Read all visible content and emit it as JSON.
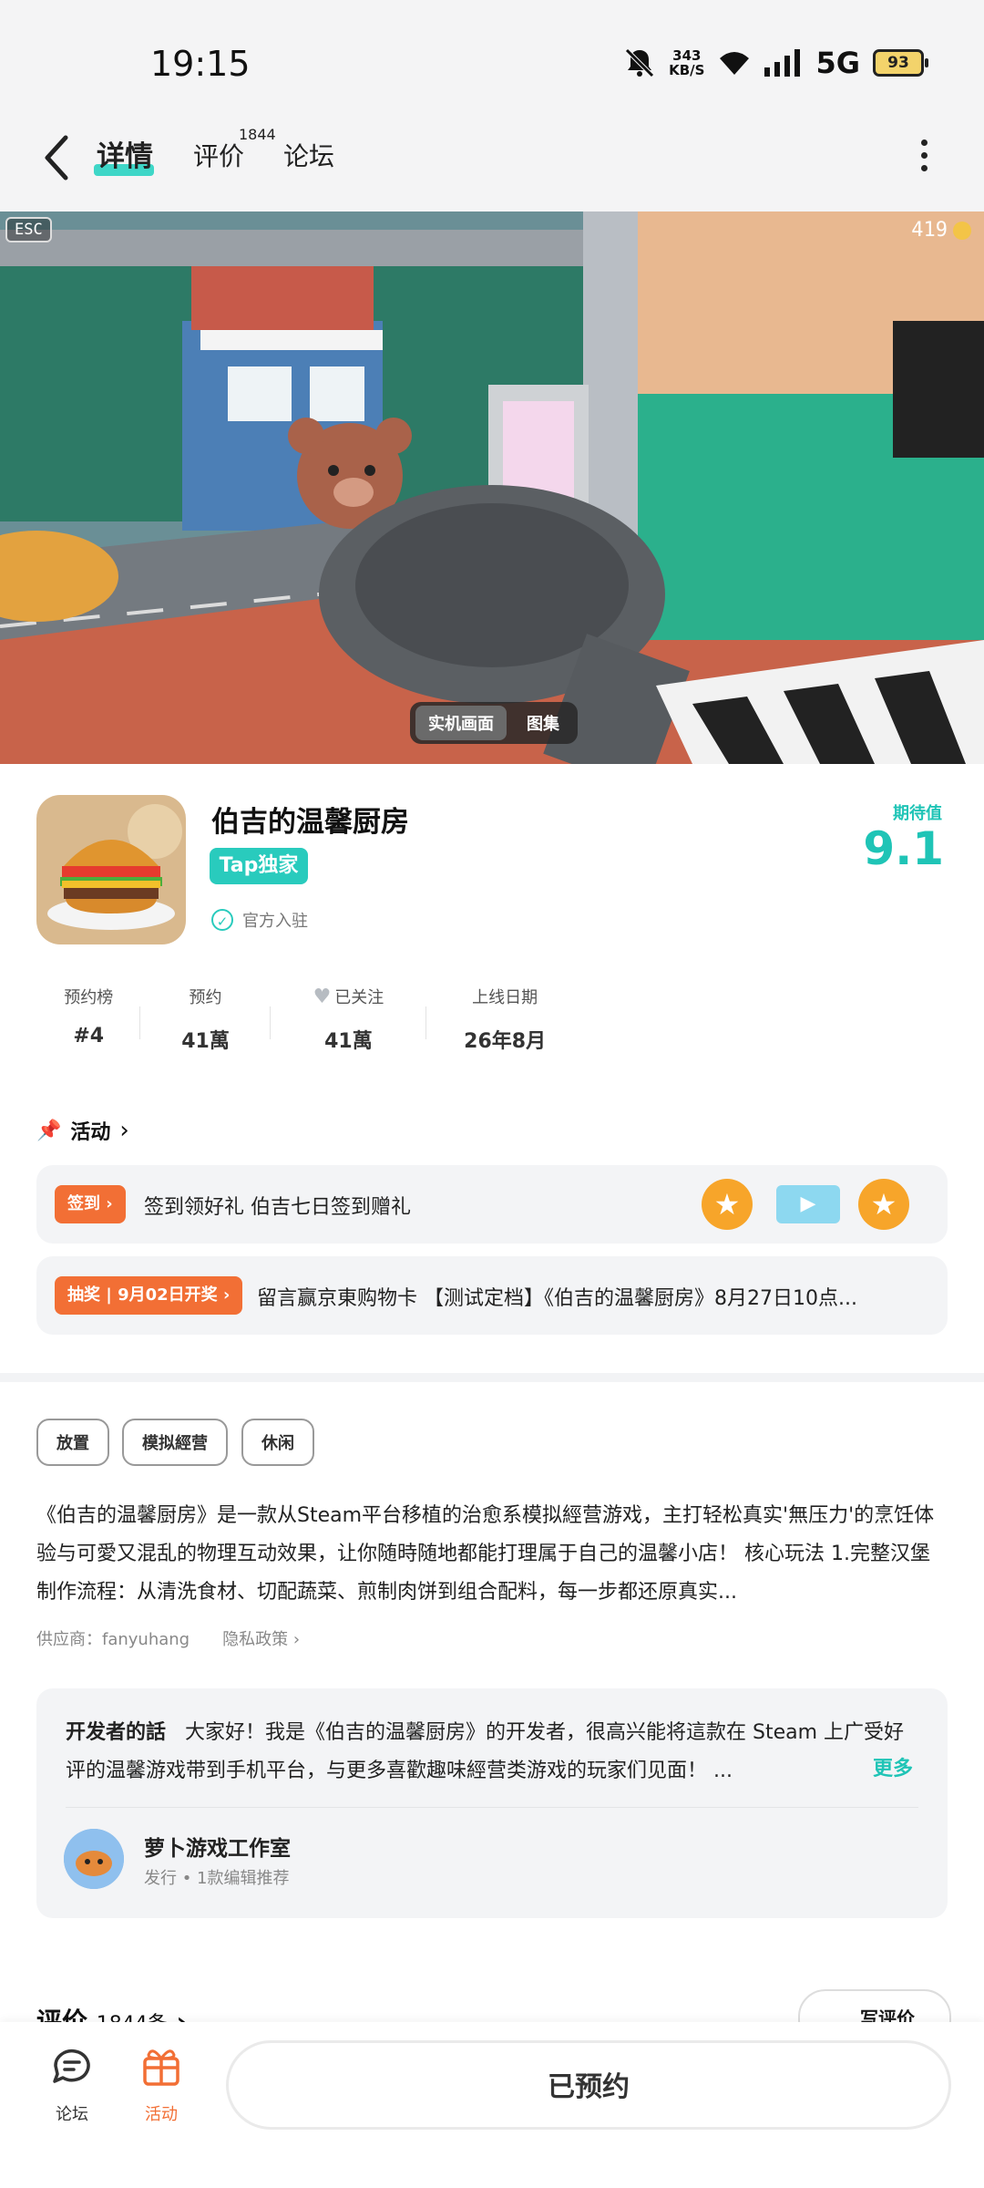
{
  "status_bar": {
    "time": "19:15",
    "net_speed_value": "343",
    "net_speed_unit": "KB/S",
    "network": "5G",
    "battery": "93"
  },
  "nav": {
    "tabs": [
      {
        "label": "详情",
        "active": true
      },
      {
        "label": "评价",
        "badge": "1844"
      },
      {
        "label": "论坛"
      }
    ]
  },
  "hero": {
    "esc": "ESC",
    "coins": "419",
    "segments": [
      {
        "label": "实机画面",
        "active": true
      },
      {
        "label": "图集"
      }
    ]
  },
  "game": {
    "title": "伯吉的温馨厨房",
    "badge": "Tap独家",
    "official": "官方入驻",
    "expectation_label": "期待值",
    "expectation_value": "9.1",
    "stats": [
      {
        "label": "预约榜",
        "value": "#4"
      },
      {
        "label": "预约",
        "value": "41萬"
      },
      {
        "label": "已关注",
        "value": "41萬"
      },
      {
        "label": "上线日期",
        "value": "26年8月"
      }
    ]
  },
  "activity": {
    "header": "活动",
    "items": [
      {
        "tag": "签到",
        "text": "签到领好礼  伯吉七日签到赠礼"
      },
      {
        "tag": "抽奖 | 9月02日开奖",
        "text": "留言赢京東购物卡 【测试定档】《伯吉的温馨厨房》8月27日10点..."
      }
    ]
  },
  "tags": [
    "放置",
    "模拟經营",
    "休闲"
  ],
  "description": "《伯吉的温馨厨房》是一款从Steam平台移植的治愈系模拟經营游戏，主打轻松真实'無压力'的烹饪体验与可愛又混乱的物理互动效果，让你随時随地都能打理属于自己的温馨小店！ 核心玩法 1.完整汉堡制作流程：从清洗食材、切配蔬菜、煎制肉饼到组合配料，每一步都还原真实...",
  "supplier": {
    "label": "供应商：fanyuhang",
    "privacy": "隐私政策"
  },
  "developer": {
    "label": "开发者的話",
    "text": "大家好！我是《伯吉的温馨厨房》的开发者，很高兴能将這款在 Steam 上广受好评的温馨游戏带到手机平台，与更多喜歡趣味經营类游戏的玩家们见面！ ...",
    "more": "更多",
    "studio_name": "萝卜游戏工作室",
    "studio_sub": "发行 • 1款编辑推荐"
  },
  "reviews": {
    "title": "评价",
    "count": "1844条",
    "write": "写评价"
  },
  "bottom_bar": {
    "forum": "论坛",
    "activity": "活动",
    "reserved": "已预约"
  },
  "colors": {
    "accent": "#1fc4b6",
    "orange": "#f26f35"
  }
}
